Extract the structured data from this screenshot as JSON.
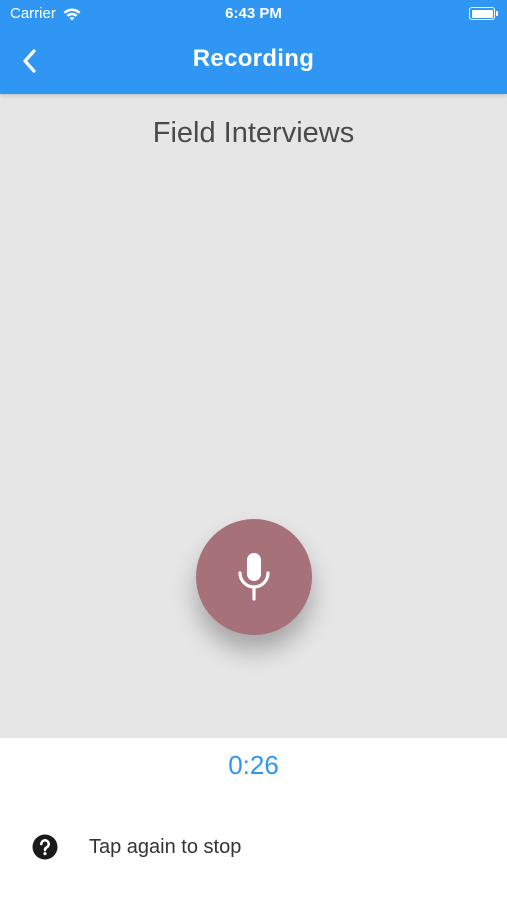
{
  "status_bar": {
    "carrier": "Carrier",
    "time": "6:43 PM"
  },
  "nav": {
    "title": "Recording"
  },
  "main": {
    "project_title": "Field Interviews"
  },
  "recorder": {
    "elapsed": "0:26",
    "hint": "Tap again to stop"
  },
  "icons": {
    "back": "chevron-left-icon",
    "mic": "microphone-icon",
    "help": "question-circle-icon",
    "wifi": "wifi-icon",
    "battery": "battery-icon"
  },
  "colors": {
    "accent": "#2f97f3",
    "stage_bg": "#e6e6e6",
    "mic_button": "#a7717a",
    "title_text": "#4a4a4a"
  }
}
